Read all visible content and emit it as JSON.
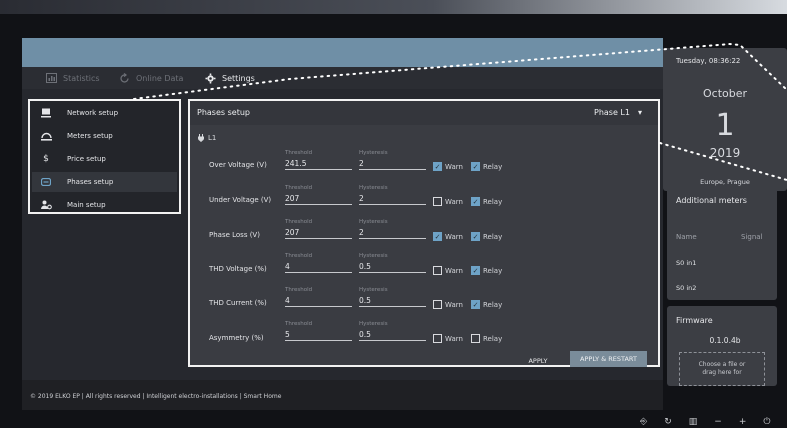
{
  "topnav": {
    "statistics": "Statistics",
    "online_data": "Online Data",
    "settings": "Settings"
  },
  "sidebar": {
    "items": [
      {
        "label": "Network setup",
        "icon": "monitor-icon"
      },
      {
        "label": "Meters setup",
        "icon": "meter-icon"
      },
      {
        "label": "Price setup",
        "icon": "dollar-icon"
      },
      {
        "label": "Phases setup",
        "icon": "phase-icon"
      },
      {
        "label": "Main setup",
        "icon": "user-gear-icon"
      }
    ],
    "active_index": 3
  },
  "panel": {
    "title": "Phases setup",
    "phase_select": "Phase L1",
    "phase_label": "L1",
    "threshold_caption": "Threshold",
    "hysteresis_caption": "Hysteresis",
    "warn_label": "Warn",
    "relay_label": "Relay",
    "rows": [
      {
        "label": "Over Voltage (V)",
        "threshold": "241.5",
        "hysteresis": "2",
        "warn": true,
        "relay": true
      },
      {
        "label": "Under Voltage (V)",
        "threshold": "207",
        "hysteresis": "2",
        "warn": false,
        "relay": true
      },
      {
        "label": "Phase Loss (V)",
        "threshold": "207",
        "hysteresis": "2",
        "warn": true,
        "relay": true
      },
      {
        "label": "THD Voltage (%)",
        "threshold": "4",
        "hysteresis": "0.5",
        "warn": false,
        "relay": true
      },
      {
        "label": "THD Current (%)",
        "threshold": "4",
        "hysteresis": "0.5",
        "warn": false,
        "relay": true
      },
      {
        "label": "Asymmetry (%)",
        "threshold": "5",
        "hysteresis": "0.5",
        "warn": false,
        "relay": false
      }
    ],
    "apply_label": "APPLY",
    "apply_restart_label": "APPLY & RESTART"
  },
  "footer": {
    "text": "© 2019 ELKO EP | All rights reserved | Intelligent electro-installations | Smart Home"
  },
  "clock": {
    "date_line": "Tuesday, 08:36:22",
    "month": "October",
    "day": "1",
    "year": "2019",
    "timezone": "Europe, Prague"
  },
  "additional_meters": {
    "title": "Additional meters",
    "col_name": "Name",
    "col_signal": "Signal",
    "rows": [
      "S0 in1",
      "S0 in2"
    ]
  },
  "firmware": {
    "title": "Firmware",
    "version": "0.1.0.4b",
    "dropzone_line1": "Choose a file or",
    "dropzone_line2": "drag here for"
  },
  "colors": {
    "accent": "#6ea3c7",
    "header_bar": "#6f8fa6",
    "panel_bg": "#3a3c42"
  }
}
